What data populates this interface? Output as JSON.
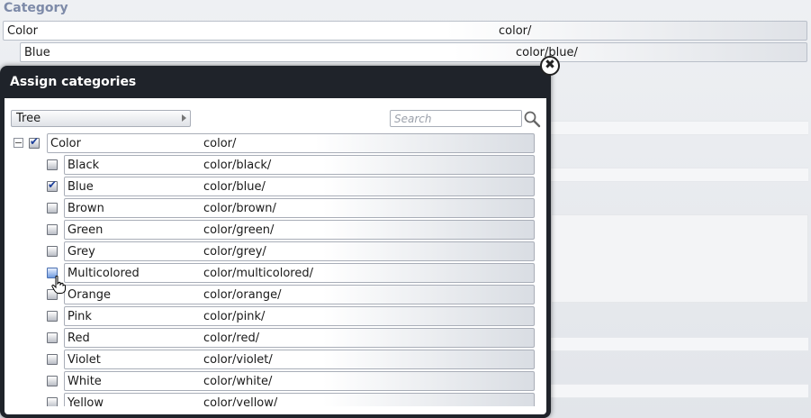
{
  "background": {
    "section_title": "Category",
    "rows": [
      {
        "name": "Color",
        "path": "color/"
      },
      {
        "name": "Blue",
        "path": "color/blue/"
      }
    ]
  },
  "dialog": {
    "title": "Assign categories",
    "close_icon": "close-icon",
    "view_select": {
      "selected": "Tree"
    },
    "search": {
      "placeholder": "Search",
      "value": "",
      "icon": "search-icon"
    },
    "tree": {
      "root": {
        "name": "Color",
        "path": "color/",
        "checked": true,
        "expanded": true
      },
      "children": [
        {
          "name": "Black",
          "path": "color/black/",
          "checked": false
        },
        {
          "name": "Blue",
          "path": "color/blue/",
          "checked": true
        },
        {
          "name": "Brown",
          "path": "color/brown/",
          "checked": false
        },
        {
          "name": "Green",
          "path": "color/green/",
          "checked": false
        },
        {
          "name": "Grey",
          "path": "color/grey/",
          "checked": false
        },
        {
          "name": "Multicolored",
          "path": "color/multicolored/",
          "checked": false,
          "hover": true
        },
        {
          "name": "Orange",
          "path": "color/orange/",
          "checked": false
        },
        {
          "name": "Pink",
          "path": "color/pink/",
          "checked": false
        },
        {
          "name": "Red",
          "path": "color/red/",
          "checked": false
        },
        {
          "name": "Violet",
          "path": "color/violet/",
          "checked": false
        },
        {
          "name": "White",
          "path": "color/white/",
          "checked": false
        },
        {
          "name": "Yellow",
          "path": "color/yellow/",
          "checked": false
        }
      ]
    }
  },
  "colors": {
    "accent_check": "#1c3f9a",
    "dialog_header": "#1f232a",
    "section_title": "#7d8aa8"
  }
}
